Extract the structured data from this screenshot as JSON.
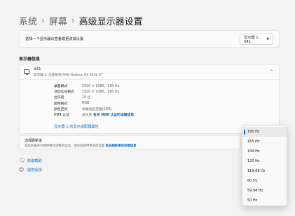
{
  "breadcrumb": [
    "系统",
    "屏幕",
    "高级显示器设置"
  ],
  "breadcrumb_sep": "›",
  "select_display": {
    "label": "选择一个显示器以查看或更改其设置",
    "value": "显示器 1: X41"
  },
  "section_title": "显示器信息",
  "monitor": {
    "name": "X41",
    "subtitle": "显示器 1: 已连接到 AMD Radeon RX 6650 XT"
  },
  "properties": [
    {
      "key": "桌面模式",
      "value": "1920 × 1080，180 Hz"
    },
    {
      "key": "活动信号模式",
      "value": "1920 × 1080，180 Hz"
    },
    {
      "key": "位深度",
      "value": "10 位"
    },
    {
      "key": "颜色格式",
      "value": "RGB"
    },
    {
      "key": "颜色空间",
      "value": "标准动态范围(SDR)"
    }
  ],
  "hdr": {
    "key": "HDR 认证",
    "value": "未找到",
    "link": "有关 HDR 认证的详细信息"
  },
  "adapter_link": "显示器 1 的显示适配器属性",
  "refresh": {
    "title": "选择刷新率",
    "desc": "较高的速率可提供更加流畅的运动，但也会使用更多的电量",
    "link": "有关刷新率的详细信息"
  },
  "footer": {
    "help": "获取帮助",
    "feedback": "提供反馈"
  },
  "refresh_options": [
    "180 Hz",
    "165 Hz",
    "144 Hz",
    "120 Hz",
    "119.88 Hz",
    "60 Hz",
    "59.94 Hz",
    "50 Hz"
  ],
  "selected_refresh": "180 Hz",
  "icons": {
    "expand": "chevron-down-icon",
    "collapse": "chevron-up-icon",
    "help": "help-icon",
    "feedback": "feedback-icon"
  },
  "colors": {
    "accent": "#0067c0",
    "background": "#f3f3f3",
    "card": "#fbfbfb"
  }
}
